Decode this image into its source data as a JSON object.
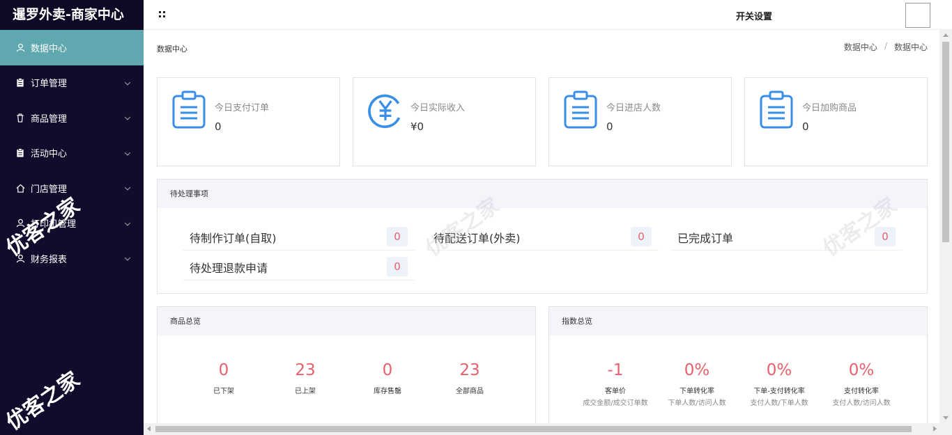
{
  "app": {
    "title": "暹罗外卖-商家中心"
  },
  "topbar": {
    "switch_settings": "开关设置"
  },
  "sidebar": {
    "items": [
      {
        "label": "数据中心",
        "icon": "user-icon"
      },
      {
        "label": "订单管理",
        "icon": "clipboard-icon"
      },
      {
        "label": "商品管理",
        "icon": "trash-icon"
      },
      {
        "label": "活动中心",
        "icon": "clipboard-icon"
      },
      {
        "label": "门店管理",
        "icon": "home-icon"
      },
      {
        "label": "打印机管理",
        "icon": "user-icon"
      },
      {
        "label": "财务报表",
        "icon": "user-icon"
      }
    ]
  },
  "page": {
    "title": "数据中心",
    "breadcrumb": [
      "数据中心",
      "/",
      "数据中心"
    ]
  },
  "stats": [
    {
      "label": "今日支付订单",
      "value": "0",
      "icon": "clipboard-icon"
    },
    {
      "label": "今日实际收入",
      "value": "¥0",
      "icon": "yuan-icon"
    },
    {
      "label": "今日进店人数",
      "value": "0",
      "icon": "clipboard-icon"
    },
    {
      "label": "今日加购商品",
      "value": "0",
      "icon": "clipboard-icon"
    }
  ],
  "pending": {
    "title": "待处理事项",
    "items": [
      {
        "label": "待制作订单(自取)",
        "count": "0"
      },
      {
        "label": "待配送订单(外卖)",
        "count": "0"
      },
      {
        "label": "已完成订单",
        "count": "0"
      },
      {
        "label": "待处理退款申请",
        "count": "0"
      }
    ]
  },
  "goods": {
    "title": "商品总览",
    "items": [
      {
        "value": "0",
        "label": "已下架"
      },
      {
        "value": "23",
        "label": "已上架"
      },
      {
        "value": "0",
        "label": "库存售罄"
      },
      {
        "value": "23",
        "label": "全部商品"
      }
    ]
  },
  "index": {
    "title": "指数总览",
    "items": [
      {
        "value": "-1",
        "label": "客单价",
        "sub": "成交金额/成交订单数"
      },
      {
        "value": "0%",
        "label": "下单转化率",
        "sub": "下单人数/访问人数"
      },
      {
        "value": "0%",
        "label": "下单-支付转化率",
        "sub": "支付人数/下单人数"
      },
      {
        "value": "0%",
        "label": "支付转化率",
        "sub": "支付人数/访问人数"
      }
    ]
  },
  "watermark": "优客之家",
  "colors": {
    "sidebar_bg": "#0f0d2b",
    "active": "#5fa8b0",
    "accent_blue": "#3a8ee6",
    "count_red": "#e8606c"
  }
}
